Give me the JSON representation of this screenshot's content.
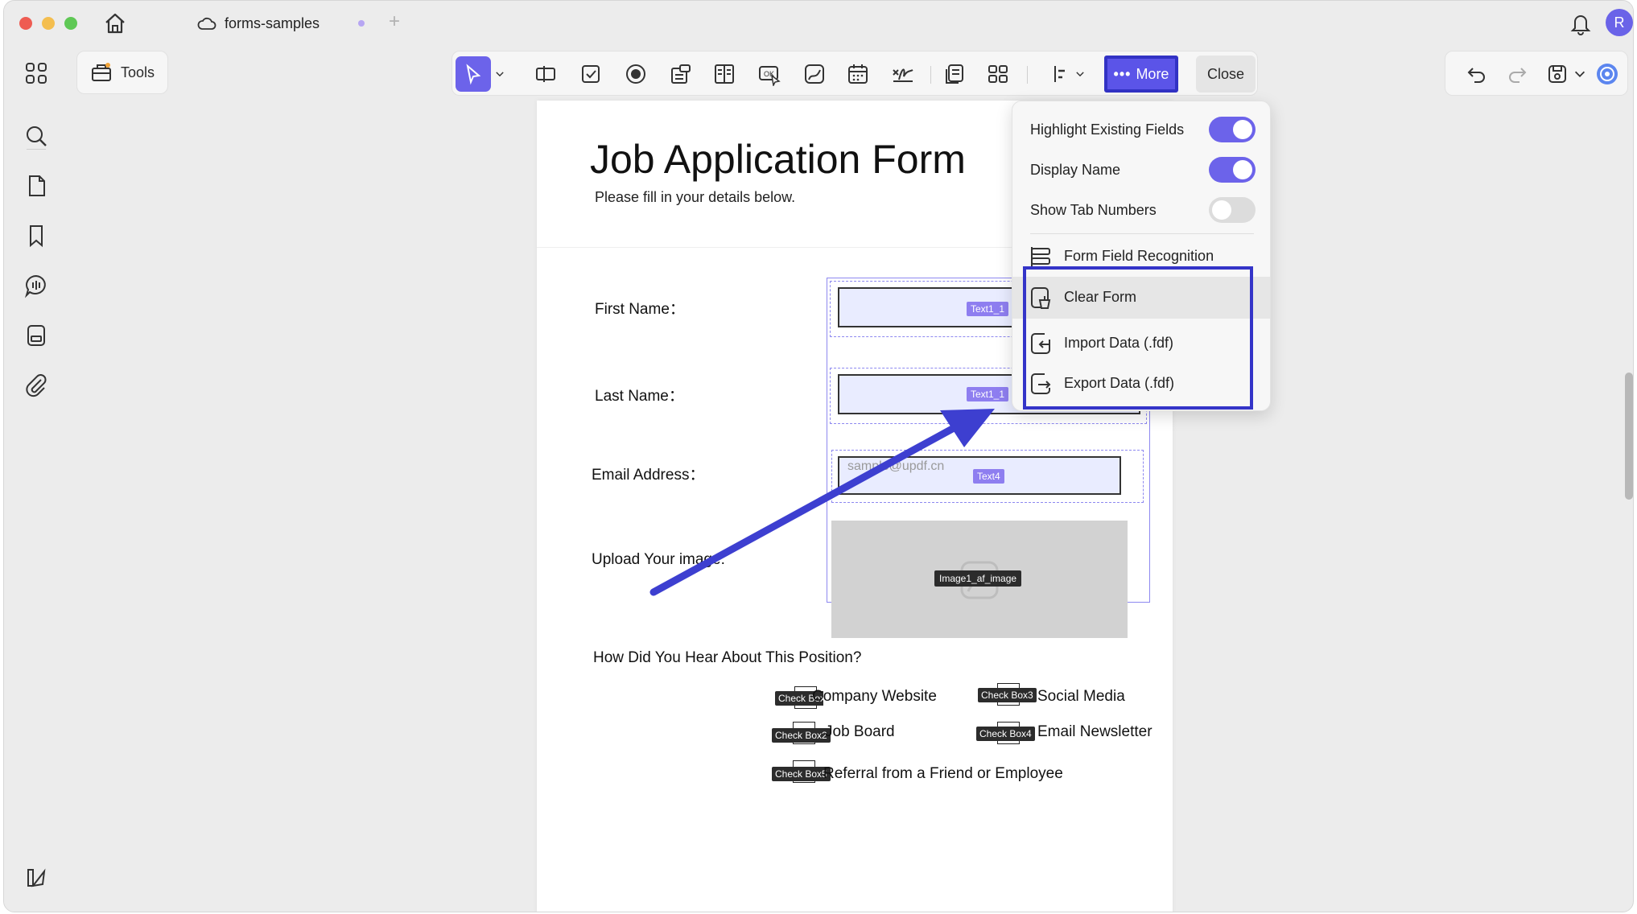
{
  "window": {
    "tab_title": "forms-samples",
    "new_tab": "+",
    "avatar_initial": "R"
  },
  "left_panel": {
    "tools_label": "Tools"
  },
  "toolbar": {
    "more_label": "More",
    "more_dots": "•••",
    "close_label": "Close"
  },
  "document": {
    "title": "Job Application Form",
    "subtitle": "Please fill in your details below.",
    "labels": {
      "first_name": "First Name：",
      "last_name": "Last Name：",
      "email": "Email Address：",
      "upload": "Upload Your image:",
      "hear_about": "How Did You Hear About This Position?"
    },
    "fields": {
      "first_name_tag": "Text1_1",
      "last_name_tag": "Text1_1",
      "email_tag": "Text4",
      "email_placeholder": "sample@updf.cn",
      "image_tag": "Image1_af_image"
    },
    "checkboxes": [
      {
        "tag": "Check Box1",
        "label": "Company Website"
      },
      {
        "tag": "Check Box2",
        "label": "Job Board"
      },
      {
        "tag": "Check Box3",
        "label": "Social Media"
      },
      {
        "tag": "Check Box4",
        "label": "Email Newsletter"
      },
      {
        "tag": "Check Box5",
        "label": "Referral from a Friend or Employee"
      }
    ]
  },
  "menu": {
    "highlight_existing_fields": {
      "label": "Highlight Existing Fields",
      "on": true
    },
    "display_name": {
      "label": "Display Name",
      "on": true
    },
    "show_tab_numbers": {
      "label": "Show Tab Numbers",
      "on": false
    },
    "items": [
      {
        "label": "Form Field Recognition"
      },
      {
        "label": "Clear Form"
      },
      {
        "label": "Import Data (.fdf)"
      },
      {
        "label": "Export Data (.fdf)"
      }
    ]
  },
  "colors": {
    "accent": "#6c63ea",
    "highlight_border": "#3434c8",
    "arrow": "#3d3fd0"
  }
}
